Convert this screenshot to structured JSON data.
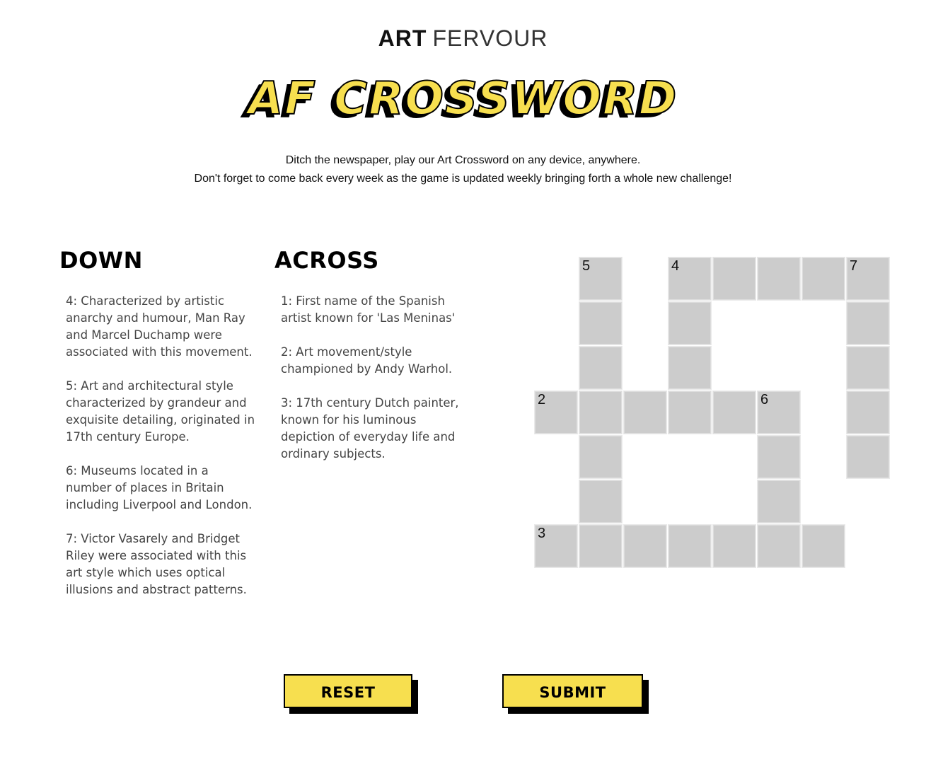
{
  "brand": {
    "part1": "ART",
    "part2": "FERVOUR"
  },
  "title": "AF CROSSWORD",
  "intro": {
    "line1": "Ditch the newspaper, play our Art Crossword on any device, anywhere.",
    "line2": "Don't forget to come back every week as the game is updated weekly bringing forth a whole new challenge!"
  },
  "down": {
    "heading": "DOWN",
    "clues": [
      "4: Characterized by artistic anarchy and humour, Man Ray and Marcel Duchamp were associated with this movement.",
      "5: Art and architectural style characterized by grandeur and exquisite detailing, originated in 17th century Europe.",
      "6: Museums located in a number of places in Britain including Liverpool and London.",
      "7: Victor Vasarely and Bridget Riley were associated with this art style which uses optical illusions and abstract patterns."
    ]
  },
  "across": {
    "heading": "ACROSS",
    "clues": [
      "1: First name of the Spanish artist known for 'Las Meninas'",
      "2: Art movement/style championed by Andy Warhol.",
      "3: 17th century Dutch painter, known for his luminous depiction of everyday life and ordinary subjects."
    ]
  },
  "grid": {
    "numbers": {
      "5": "5",
      "4": "4",
      "7": "7",
      "2": "2",
      "6": "6",
      "3": "3"
    }
  },
  "buttons": {
    "reset": "RESET",
    "submit": "SUBMIT"
  },
  "colors": {
    "accent": "#f7df4f",
    "cell": "#cccccc",
    "text": "#444444"
  }
}
